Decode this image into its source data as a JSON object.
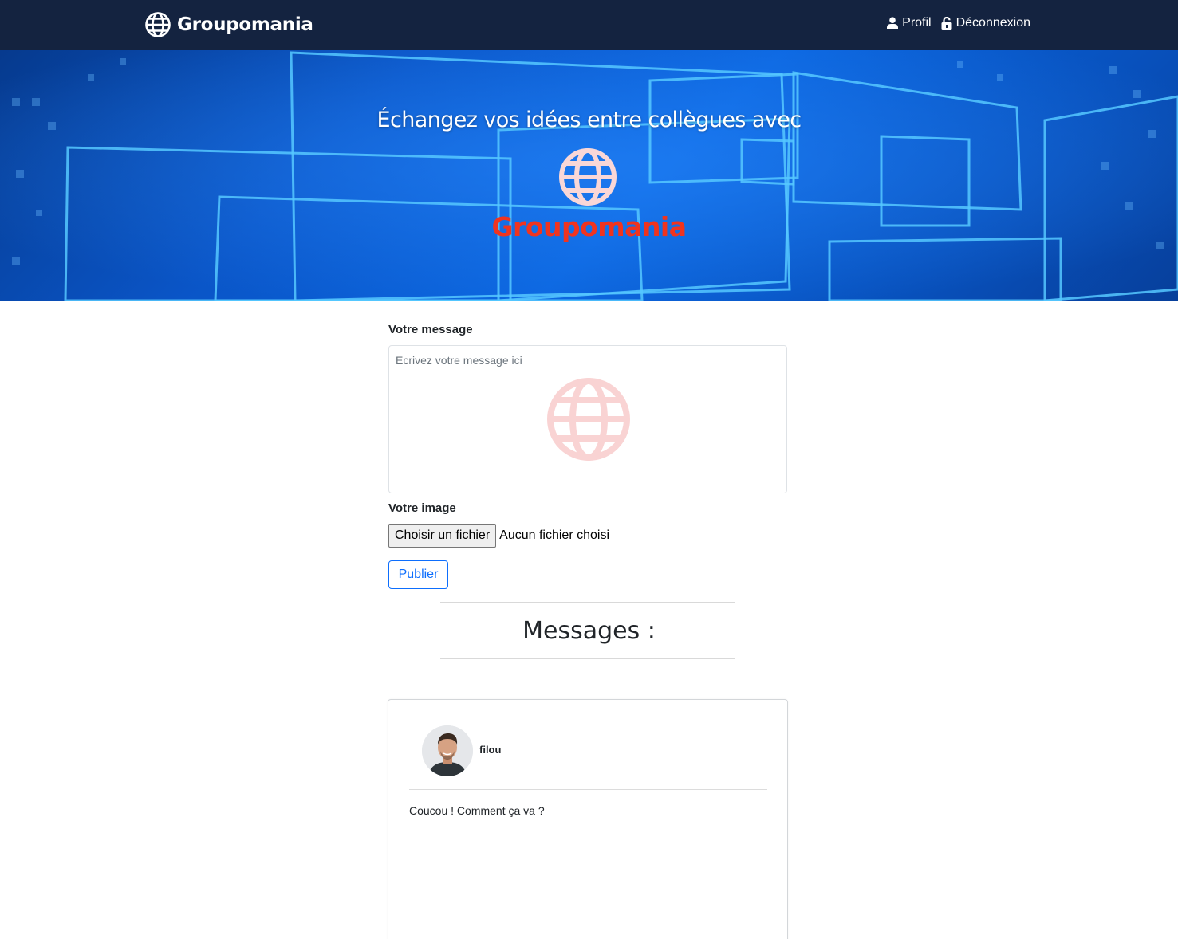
{
  "navbar": {
    "brand": "Groupomania",
    "links": [
      {
        "label": "Profil",
        "icon": "user-icon"
      },
      {
        "label": "Déconnexion",
        "icon": "unlock-icon"
      }
    ],
    "background": "#142340"
  },
  "hero": {
    "title": "Échangez vos idées entre collègues avec",
    "brand": "Groupomania",
    "brand_color": "#f0341f",
    "logo_icon": "globe-icon"
  },
  "form": {
    "message_label": "Votre message",
    "message_placeholder": "Ecrivez votre message ici",
    "image_label": "Votre image",
    "file_button": "Choisir un fichier",
    "file_status": "Aucun fichier choisi",
    "publish_button": "Publier",
    "accent": "#0d6efd"
  },
  "messages": {
    "heading": "Messages :",
    "posts": [
      {
        "author": "filou",
        "text": "Coucou ! Comment ça va ?"
      }
    ]
  }
}
